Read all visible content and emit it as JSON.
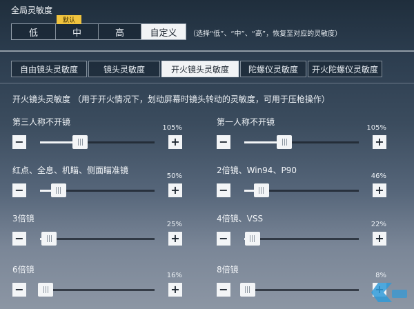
{
  "global": {
    "title": "全局灵敏度",
    "options": [
      "低",
      "中",
      "高",
      "自定义"
    ],
    "active_index": 3,
    "default_badge": "默认",
    "hint": "（选择“低”、“中”、“高”，恢复至对应的灵敏度）"
  },
  "tabs": {
    "items": [
      "自由镜头灵敏度",
      "镜头灵敏度",
      "开火镜头灵敏度",
      "陀螺仪灵敏度",
      "开火陀螺仪灵敏度"
    ],
    "active_index": 2
  },
  "section": {
    "description": "开火镜头灵敏度 （用于开火情况下，划动屏幕时镜头转动的灵敏度，可用于压枪操作）"
  },
  "controls": {
    "minus_symbol": "−",
    "plus_symbol": "+"
  },
  "sliders": [
    {
      "label": "第三人称不开镜",
      "value": "105%",
      "level": 0.35
    },
    {
      "label": "第一人称不开镜",
      "value": "105%",
      "level": 0.35
    },
    {
      "label": "红点、全息、机瞄、侧面瞄准镜",
      "value": "50%",
      "level": 0.16
    },
    {
      "label": "2倍镜、Win94、P90",
      "value": "46%",
      "level": 0.15
    },
    {
      "label": "3倍镜",
      "value": "25%",
      "level": 0.08
    },
    {
      "label": "4倍镜、VSS",
      "value": "22%",
      "level": 0.07
    },
    {
      "label": "6倍镜",
      "value": "16%",
      "level": 0.05
    },
    {
      "label": "8倍镜",
      "value": "8%",
      "level": 0.03
    }
  ],
  "colors": {
    "accent_badge": "#f1c43e",
    "active_tab": "#f1f3f5"
  }
}
